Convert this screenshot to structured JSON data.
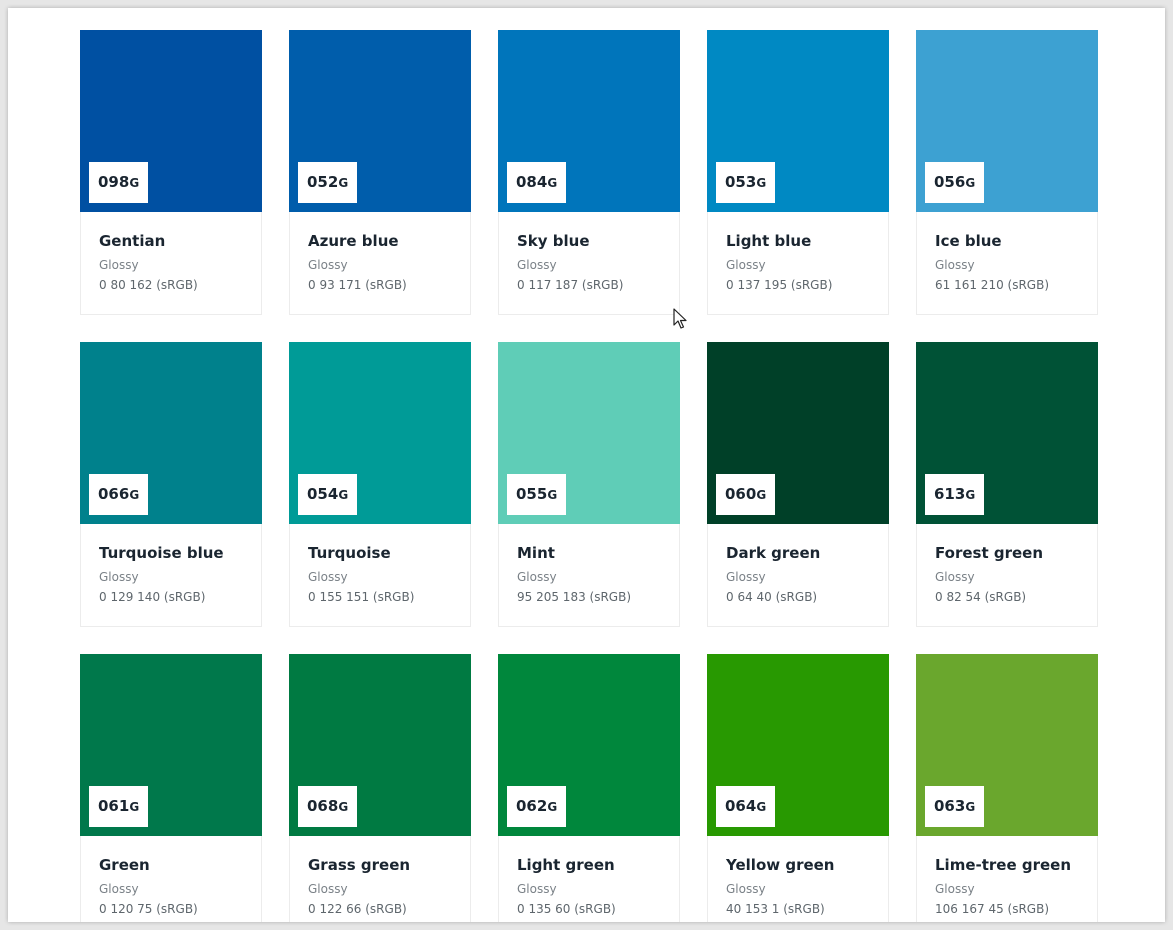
{
  "colors": [
    {
      "code": "098",
      "suffix": "G",
      "name": "Gentian",
      "finish": "Glossy",
      "rgb": "0 80 162 (sRGB)",
      "hex": "#0050a2"
    },
    {
      "code": "052",
      "suffix": "G",
      "name": "Azure blue",
      "finish": "Glossy",
      "rgb": "0 93 171 (sRGB)",
      "hex": "#005dab"
    },
    {
      "code": "084",
      "suffix": "G",
      "name": "Sky blue",
      "finish": "Glossy",
      "rgb": "0 117 187 (sRGB)",
      "hex": "#0075bb"
    },
    {
      "code": "053",
      "suffix": "G",
      "name": "Light blue",
      "finish": "Glossy",
      "rgb": "0 137 195 (sRGB)",
      "hex": "#0089c3"
    },
    {
      "code": "056",
      "suffix": "G",
      "name": "Ice blue",
      "finish": "Glossy",
      "rgb": "61 161 210 (sRGB)",
      "hex": "#3da1d2"
    },
    {
      "code": "066",
      "suffix": "G",
      "name": "Turquoise blue",
      "finish": "Glossy",
      "rgb": "0 129 140 (sRGB)",
      "hex": "#00818c"
    },
    {
      "code": "054",
      "suffix": "G",
      "name": "Turquoise",
      "finish": "Glossy",
      "rgb": "0 155 151 (sRGB)",
      "hex": "#009b97"
    },
    {
      "code": "055",
      "suffix": "G",
      "name": "Mint",
      "finish": "Glossy",
      "rgb": "95 205 183 (sRGB)",
      "hex": "#5fcdb7"
    },
    {
      "code": "060",
      "suffix": "G",
      "name": "Dark green",
      "finish": "Glossy",
      "rgb": "0 64 40 (sRGB)",
      "hex": "#004028"
    },
    {
      "code": "613",
      "suffix": "G",
      "name": "Forest green",
      "finish": "Glossy",
      "rgb": "0 82 54 (sRGB)",
      "hex": "#005236"
    },
    {
      "code": "061",
      "suffix": "G",
      "name": "Green",
      "finish": "Glossy",
      "rgb": "0 120 75 (sRGB)",
      "hex": "#00784b"
    },
    {
      "code": "068",
      "suffix": "G",
      "name": "Grass green",
      "finish": "Glossy",
      "rgb": "0 122 66 (sRGB)",
      "hex": "#007a42"
    },
    {
      "code": "062",
      "suffix": "G",
      "name": "Light green",
      "finish": "Glossy",
      "rgb": "0 135 60 (sRGB)",
      "hex": "#00873c"
    },
    {
      "code": "064",
      "suffix": "G",
      "name": "Yellow green",
      "finish": "Glossy",
      "rgb": "40 153 1 (sRGB)",
      "hex": "#289901"
    },
    {
      "code": "063",
      "suffix": "G",
      "name": "Lime-tree green",
      "finish": "Glossy",
      "rgb": "106 167 45 (sRGB)",
      "hex": "#6aa72d"
    }
  ]
}
